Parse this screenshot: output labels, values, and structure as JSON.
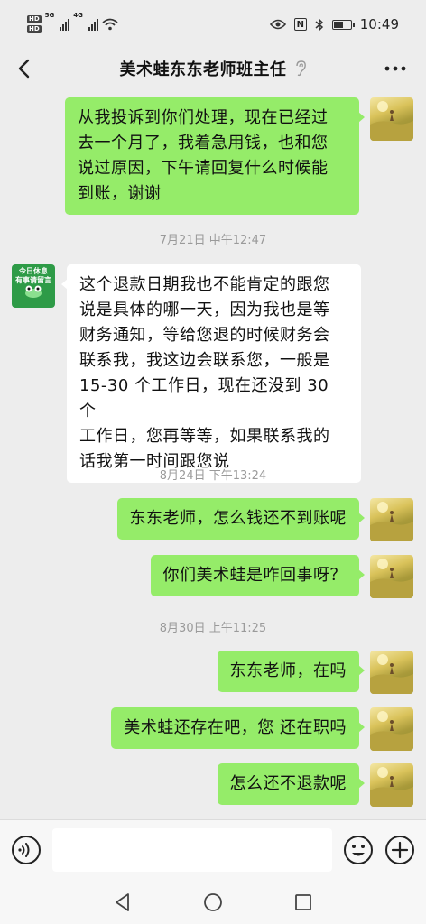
{
  "status_bar": {
    "hd_label": "HD",
    "network_label_1": "5G",
    "network_label_2": "4G",
    "nfc_label": "N",
    "time": "10:49"
  },
  "nav": {
    "title": "美术蛙东东老师班主任"
  },
  "teacher_avatar": {
    "line1": "今日休息",
    "line2": "有事请留言"
  },
  "messages": [
    {
      "side": "out",
      "text": "从我投诉到你们处理，现在已经过\n去一个月了，我着急用钱，也和您\n说过原因，下午请回复什么时候能\n到账，谢谢"
    },
    {
      "side": "time",
      "text": "7月21日 中午12:47"
    },
    {
      "side": "in",
      "text": "这个退款日期我也不能肯定的跟您\n说是具体的哪一天，因为我也是等\n财务通知，等给您退的时候财务会\n联系我，我这边会联系您，一般是\n15-30 个工作日，现在还没到 30 个\n工作日，您再等等，如果联系我的\n话我第一时间跟您说"
    },
    {
      "side": "time",
      "text": "8月24日 下午13:24"
    },
    {
      "side": "out",
      "text": "东东老师，怎么钱还不到账呢"
    },
    {
      "side": "out",
      "text": "你们美术蛙是咋回事呀？"
    },
    {
      "side": "time",
      "text": "8月30日 上午11:25"
    },
    {
      "side": "out",
      "text": "东东老师，在吗"
    },
    {
      "side": "out",
      "text": "美术蛙还存在吧，您 还在职吗"
    },
    {
      "side": "out",
      "text": "怎么还不退款呢"
    }
  ],
  "input_bar": {
    "value": "",
    "placeholder": ""
  },
  "colors": {
    "outgoing_bubble": "#95ec69",
    "incoming_bubble": "#ffffff",
    "chat_background": "#ededed",
    "teacher_avatar": "#2e9b47"
  },
  "icons": {
    "nav_back": "chevron-left-icon",
    "nav_earpiece": "ear-icon",
    "nav_more": "more-dots-icon",
    "voice": "voice-icon",
    "emoji": "emoji-icon",
    "plus": "plus-icon",
    "sys_back": "triangle-back-icon",
    "sys_home": "circle-home-icon",
    "sys_recent": "square-recent-icon"
  }
}
